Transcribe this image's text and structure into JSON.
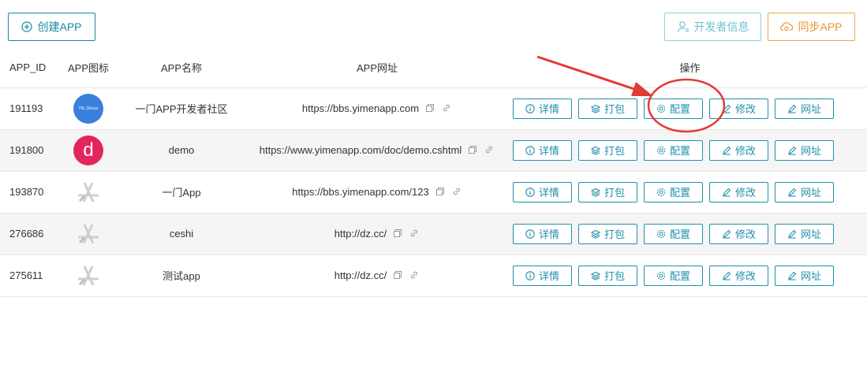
{
  "toolbar": {
    "create_label": "创建APP",
    "developer_label": "开发者信息",
    "sync_label": "同步APP"
  },
  "columns": {
    "id": "APP_ID",
    "icon": "APP图标",
    "name": "APP名称",
    "url": "APP网址",
    "ops": "操作"
  },
  "actions": {
    "detail": "详情",
    "pack": "打包",
    "config": "配置",
    "edit": "修改",
    "site": "网址"
  },
  "rows": [
    {
      "id": "191193",
      "icon": "ym-discuz-avatar",
      "icon_text": "YM_Discuz",
      "name": "一门APP开发者社区",
      "url": "https://bbs.yimenapp.com"
    },
    {
      "id": "191800",
      "icon": "letter-d-avatar",
      "icon_text": "d",
      "name": "demo",
      "url": "https://www.yimenapp.com/doc/demo.cshtml"
    },
    {
      "id": "193870",
      "icon": "app-placeholder-icon",
      "name": "一门App",
      "url": "https://bbs.yimenapp.com/123"
    },
    {
      "id": "276686",
      "icon": "app-placeholder-icon",
      "name": "ceshi",
      "url": "http://dz.cc/"
    },
    {
      "id": "275611",
      "icon": "app-placeholder-icon",
      "name": "测试app",
      "url": "http://dz.cc/"
    }
  ],
  "colors": {
    "primary": "#2190ad",
    "developer": "#6cc0d2",
    "sync": "#e59632",
    "annotation": "#e53935",
    "avatar_blue": "#3a7fdc",
    "avatar_pink": "#e3255e"
  }
}
